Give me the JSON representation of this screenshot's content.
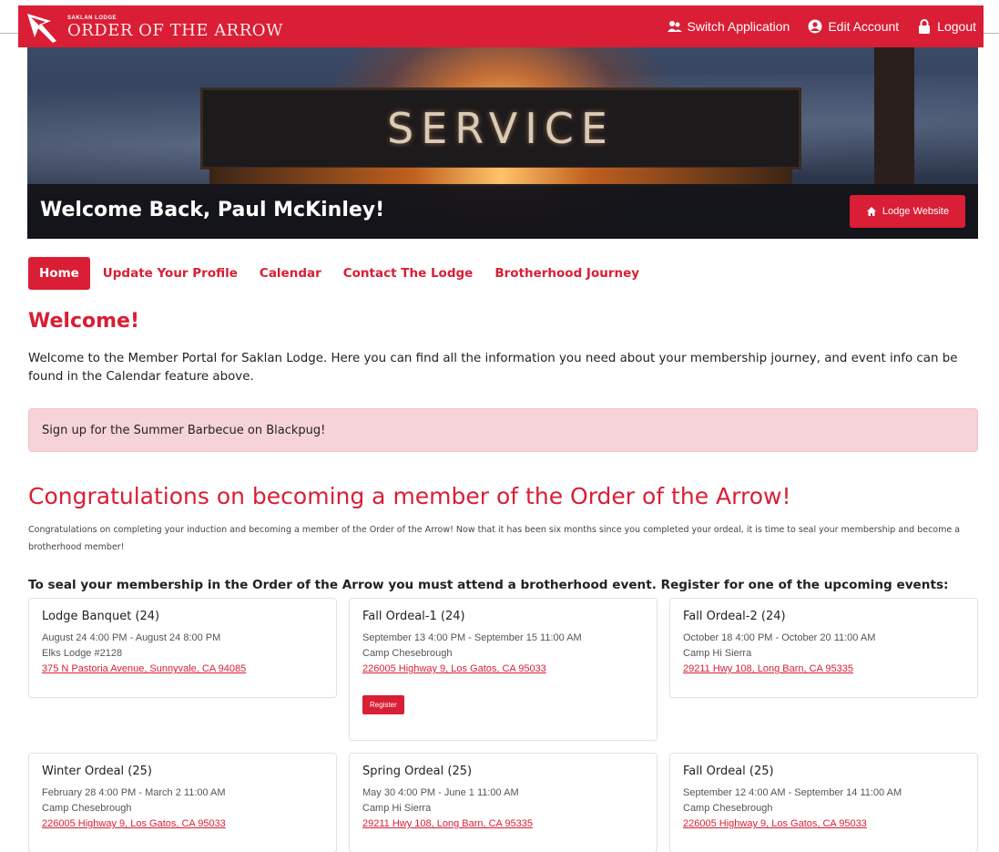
{
  "navbar": {
    "brand_small": "SAKLAN LODGE",
    "brand_big": "ORDER OF THE ARROW",
    "links": [
      {
        "label": "Switch Application",
        "icon": "users-icon"
      },
      {
        "label": "Edit Account",
        "icon": "user-circle-icon"
      },
      {
        "label": "Logout",
        "icon": "lock-icon"
      }
    ]
  },
  "hero": {
    "sign_text": "SERVICE",
    "welcome": "Welcome Back, Paul McKinley!",
    "lodge_button": "Lodge Website"
  },
  "tabs": [
    "Home",
    "Update Your Profile",
    "Calendar",
    "Contact The Lodge",
    "Brotherhood Journey"
  ],
  "welcome": {
    "heading": "Welcome!",
    "text": "Welcome to the Member Portal for Saklan Lodge. Here you can find all the information you need about your membership journey, and event info can be found in the Calendar feature above.",
    "alert": "Sign up for the Summer Barbecue on Blackpug!"
  },
  "congrats": {
    "heading": "Congratulations on becoming a member of the Order of the Arrow!",
    "text": "Congratulations on completing your induction and becoming a member of the Order of the Arrow! Now that it has been six months since you completed your ordeal, it is time to seal your membership and become a brotherhood member!",
    "seal_heading": "To seal your membership in the Order of the Arrow you must attend a brotherhood event. Register for one of the upcoming events:"
  },
  "events": [
    {
      "title": "Lodge Banquet (24)",
      "when": "August 24 4:00 PM - August 24 8:00 PM",
      "place": "Elks Lodge #2128",
      "address": "375 N Pastoria Avenue, Sunnyvale, CA 94085"
    },
    {
      "title": "Fall Ordeal-1 (24)",
      "when": "September 13 4:00 PM - September 15 11:00 AM",
      "place": "Camp Chesebrough",
      "address": "226005 Highway 9, Los Gatos, CA 95033",
      "button": "Register"
    },
    {
      "title": "Fall Ordeal-2 (24)",
      "when": "October 18 4:00 PM - October 20 11:00 AM",
      "place": "Camp Hi Sierra",
      "address": "29211 Hwy 108, Long Barn, CA 95335"
    },
    {
      "title": "Winter Ordeal (25)",
      "when": "February 28 4:00 PM - March 2 11:00 AM",
      "place": "Camp Chesebrough",
      "address": "226005 Highway 9, Los Gatos, CA 95033"
    },
    {
      "title": "Spring Ordeal (25)",
      "when": "May 30 4:00 PM - June 1 11:00 AM",
      "place": "Camp Hi Sierra",
      "address": "29211 Hwy 108, Long Barn, CA 95335"
    },
    {
      "title": "Fall Ordeal (25)",
      "when": "September 12 4:00 AM - September 14 11:00 AM",
      "place": "Camp Chesebrough",
      "address": "226005 Highway 9, Los Gatos, CA 95033"
    }
  ],
  "colors": {
    "accent": "#d91e35",
    "alert_bg": "#f5d3d8"
  }
}
